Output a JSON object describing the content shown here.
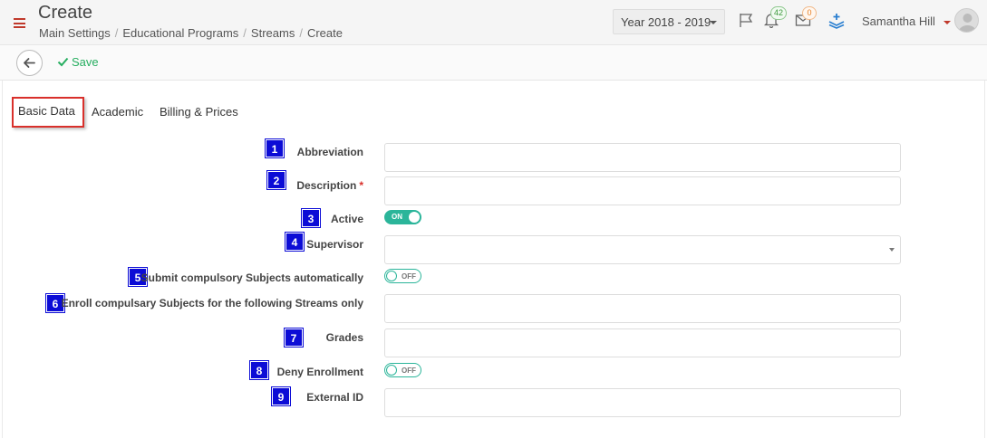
{
  "header": {
    "title": "Create",
    "breadcrumb": [
      "Main Settings",
      "Educational Programs",
      "Streams",
      "Create"
    ],
    "year_select": "Year 2018 - 2019",
    "notifications_count": "42",
    "messages_count": "0",
    "user_name": "Samantha Hill"
  },
  "toolbar": {
    "save_label": "Save"
  },
  "tabs": [
    {
      "label": "Basic Data",
      "active": true
    },
    {
      "label": "Academic",
      "active": false
    },
    {
      "label": "Billing & Prices",
      "active": false
    }
  ],
  "form": {
    "fields": [
      {
        "number": "1",
        "label": "Abbreviation",
        "type": "text",
        "value": ""
      },
      {
        "number": "2",
        "label": "Description",
        "required_mark": "*",
        "type": "text",
        "value": ""
      },
      {
        "number": "3",
        "label": "Active",
        "type": "toggle",
        "value": "ON"
      },
      {
        "number": "4",
        "label": "Supervisor",
        "type": "select",
        "value": ""
      },
      {
        "number": "5",
        "label": "Submit compulsory Subjects automatically",
        "type": "toggle",
        "value": "OFF"
      },
      {
        "number": "6",
        "label": "Enroll compulsary Subjects for the following Streams only",
        "type": "text",
        "value": ""
      },
      {
        "number": "7",
        "label": "Grades",
        "type": "text",
        "value": ""
      },
      {
        "number": "8",
        "label": "Deny Enrollment",
        "type": "toggle",
        "value": "OFF"
      },
      {
        "number": "9",
        "label": "External ID",
        "type": "text",
        "value": ""
      }
    ]
  },
  "colors": {
    "accent_red": "#d9302b",
    "toggle_green": "#2bb59a",
    "save_green": "#27ae60",
    "number_badge_blue": "#0c0cd6"
  },
  "icons": [
    "menu-icon",
    "back-arrow-icon",
    "check-icon",
    "flag-icon",
    "bell-icon",
    "envelope-icon",
    "layers-icon",
    "avatar-icon"
  ]
}
